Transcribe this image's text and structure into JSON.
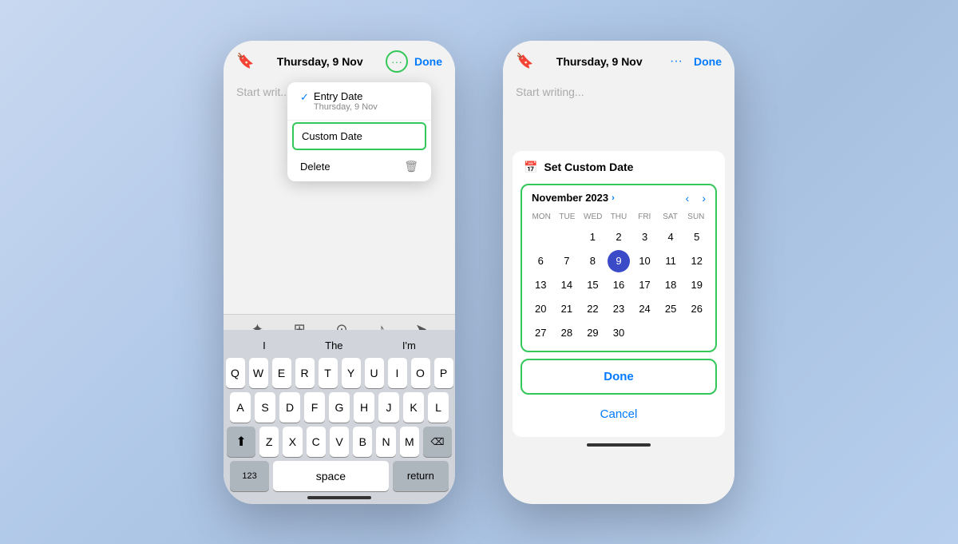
{
  "phone1": {
    "header": {
      "date": "Thursday, 9 Nov",
      "done_label": "Done"
    },
    "menu": {
      "entry_date_label": "Entry Date",
      "entry_date_sub": "Thursday, 9 Nov",
      "custom_date_label": "Custom Date",
      "delete_label": "Delete"
    },
    "writing_placeholder": "Start writ...",
    "toolbar_icons": [
      "✦",
      "⊞",
      "⊙",
      "♪",
      "➤"
    ],
    "suggestions": [
      "I",
      "The",
      "I'm"
    ],
    "keyboard_rows": [
      [
        "Q",
        "W",
        "E",
        "R",
        "T",
        "Y",
        "U",
        "I",
        "O",
        "P"
      ],
      [
        "A",
        "S",
        "D",
        "F",
        "G",
        "H",
        "J",
        "K",
        "L"
      ],
      [
        "Z",
        "X",
        "C",
        "V",
        "B",
        "N",
        "M"
      ]
    ],
    "special_keys": {
      "shift": "⬆",
      "delete": "⌫",
      "numbers": "123",
      "space": "space",
      "return": "return"
    }
  },
  "phone2": {
    "header": {
      "date": "Thursday, 9 Nov",
      "done_label": "Done"
    },
    "writing_placeholder": "Start writing...",
    "set_custom_date_label": "Set Custom Date",
    "calendar": {
      "month_year": "November 2023",
      "day_headers": [
        "MON",
        "TUE",
        "WED",
        "THU",
        "FRI",
        "SAT",
        "SUN"
      ],
      "selected_day": 9,
      "weeks": [
        [
          "",
          "",
          "1",
          "2",
          "3",
          "4",
          "5"
        ],
        [
          "6",
          "7",
          "8",
          "9",
          "10",
          "11",
          "12"
        ],
        [
          "13",
          "14",
          "15",
          "16",
          "17",
          "18",
          "19"
        ],
        [
          "20",
          "21",
          "22",
          "23",
          "24",
          "25",
          "26"
        ],
        [
          "27",
          "28",
          "29",
          "30",
          "",
          "",
          ""
        ]
      ]
    },
    "done_label": "Done",
    "cancel_label": "Cancel"
  }
}
